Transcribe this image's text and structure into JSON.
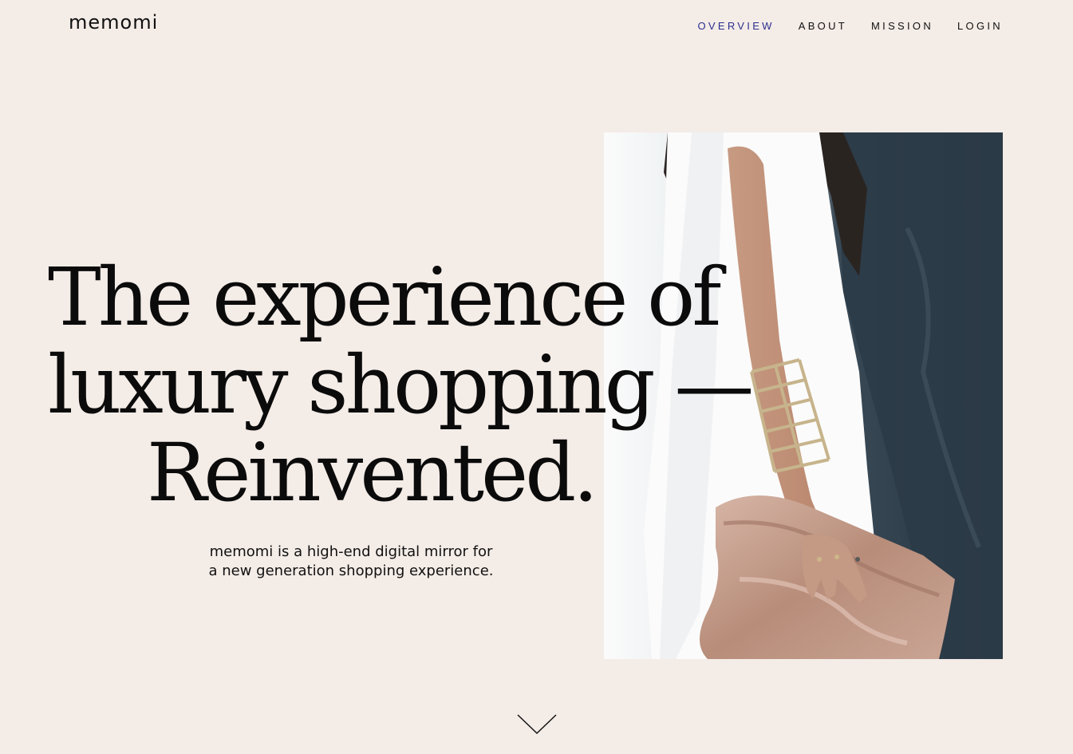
{
  "brand": {
    "logo_text": "memomi"
  },
  "nav": {
    "items": [
      {
        "label": "OVERVIEW",
        "active": true
      },
      {
        "label": "ABOUT",
        "active": false
      },
      {
        "label": "MISSION",
        "active": false
      },
      {
        "label": "LOGIN",
        "active": false
      }
    ]
  },
  "hero": {
    "headline_lines": [
      "The experience of",
      "luxury shopping —",
      "Reinvented."
    ],
    "subtext_lines": [
      "memomi is a high-end digital mirror for",
      "a new generation shopping experience."
    ],
    "image": {
      "description": "photo",
      "icon": "woman-with-clutch-photo"
    },
    "scroll_icon": "chevron-down-icon"
  },
  "colors": {
    "background": "#f4ece7",
    "accent_nav": "#2b2f8f",
    "text": "#111111"
  }
}
